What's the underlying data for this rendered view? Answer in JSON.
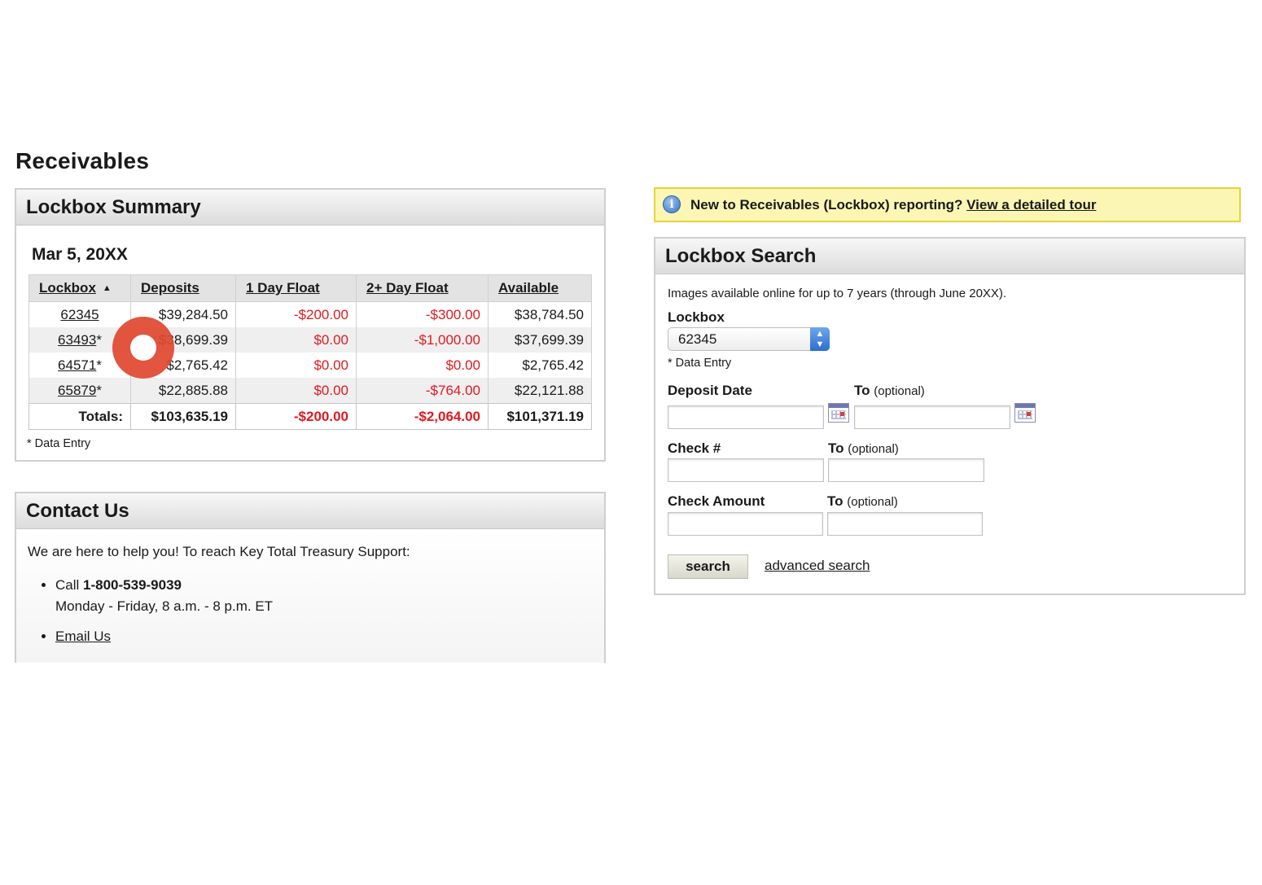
{
  "page": {
    "title": "Receivables"
  },
  "summary": {
    "header": "Lockbox Summary",
    "date": "Mar 5, 20XX",
    "columns": [
      "Lockbox",
      "Deposits",
      "1 Day Float",
      "2+ Day Float",
      "Available"
    ],
    "sort_indicator": "▲",
    "rows": [
      {
        "lockbox": "62345",
        "suffix": "",
        "deposits": "$39,284.50",
        "float1": "-$200.00",
        "float2": "-$300.00",
        "available": "$38,784.50"
      },
      {
        "lockbox": "63493",
        "suffix": "*",
        "deposits": "$38,699.39",
        "float1": "$0.00",
        "float2": "-$1,000.00",
        "available": "$37,699.39"
      },
      {
        "lockbox": "64571",
        "suffix": "*",
        "deposits": "$2,765.42",
        "float1": "$0.00",
        "float2": "$0.00",
        "available": "$2,765.42"
      },
      {
        "lockbox": "65879",
        "suffix": "*",
        "deposits": "$22,885.88",
        "float1": "$0.00",
        "float2": "-$764.00",
        "available": "$22,121.88"
      }
    ],
    "totals": {
      "label": "Totals:",
      "deposits": "$103,635.19",
      "float1": "-$200.00",
      "float2": "-$2,064.00",
      "available": "$101,371.19"
    },
    "footnote": "* Data Entry"
  },
  "contact": {
    "header": "Contact Us",
    "intro": "We are here to help you! To reach Key Total Treasury Support:",
    "call_prefix": "Call ",
    "phone": "1-800-539-9039",
    "hours": "Monday - Friday, 8 a.m. - 8 p.m. ET",
    "email_link": "Email Us"
  },
  "info_bar": {
    "text": "New to Receivables (Lockbox) reporting? ",
    "link": "View a detailed tour",
    "icon": "info-icon"
  },
  "search": {
    "header": "Lockbox Search",
    "note": "Images available online for up to 7 years (through June 20XX).",
    "lockbox_label": "Lockbox",
    "lockbox_value": "62345",
    "data_entry_note": "* Data Entry",
    "deposit_date_label": "Deposit Date",
    "check_label": "Check #",
    "amount_label": "Check Amount",
    "to_label": "To",
    "optional_label": "(optional)",
    "search_button": "search",
    "advanced_link": "advanced search"
  },
  "colors": {
    "negative": "#e0191f",
    "info_bg": "#fcf6b4",
    "info_border": "#e8d23a",
    "touch_marker": "#e04830"
  }
}
